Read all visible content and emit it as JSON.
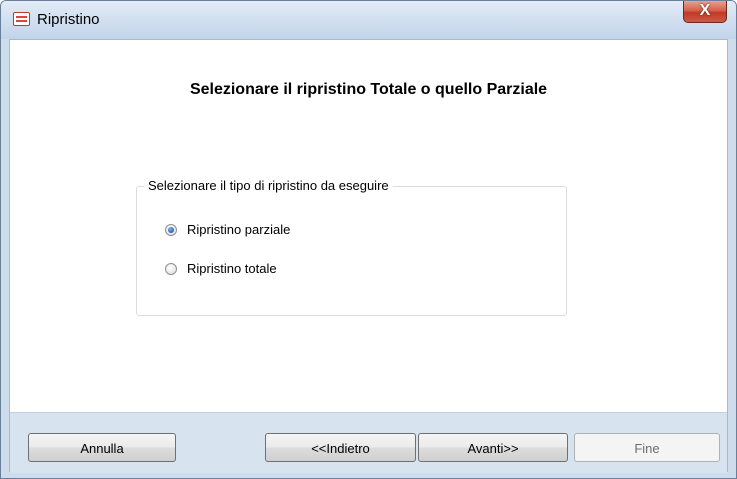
{
  "window": {
    "title": "Ripristino",
    "close_glyph": "X"
  },
  "main": {
    "heading": "Selezionare il ripristino Totale o quello Parziale",
    "group_label": "Selezionare il tipo di ripristino da eseguire",
    "options": [
      {
        "label": "Ripristino parziale",
        "checked": true
      },
      {
        "label": "Ripristino totale",
        "checked": false
      }
    ]
  },
  "footer": {
    "cancel_label": "Annulla",
    "back_label": "<<Indietro",
    "next_label": "Avanti>>",
    "finish_label": "Fine"
  }
}
